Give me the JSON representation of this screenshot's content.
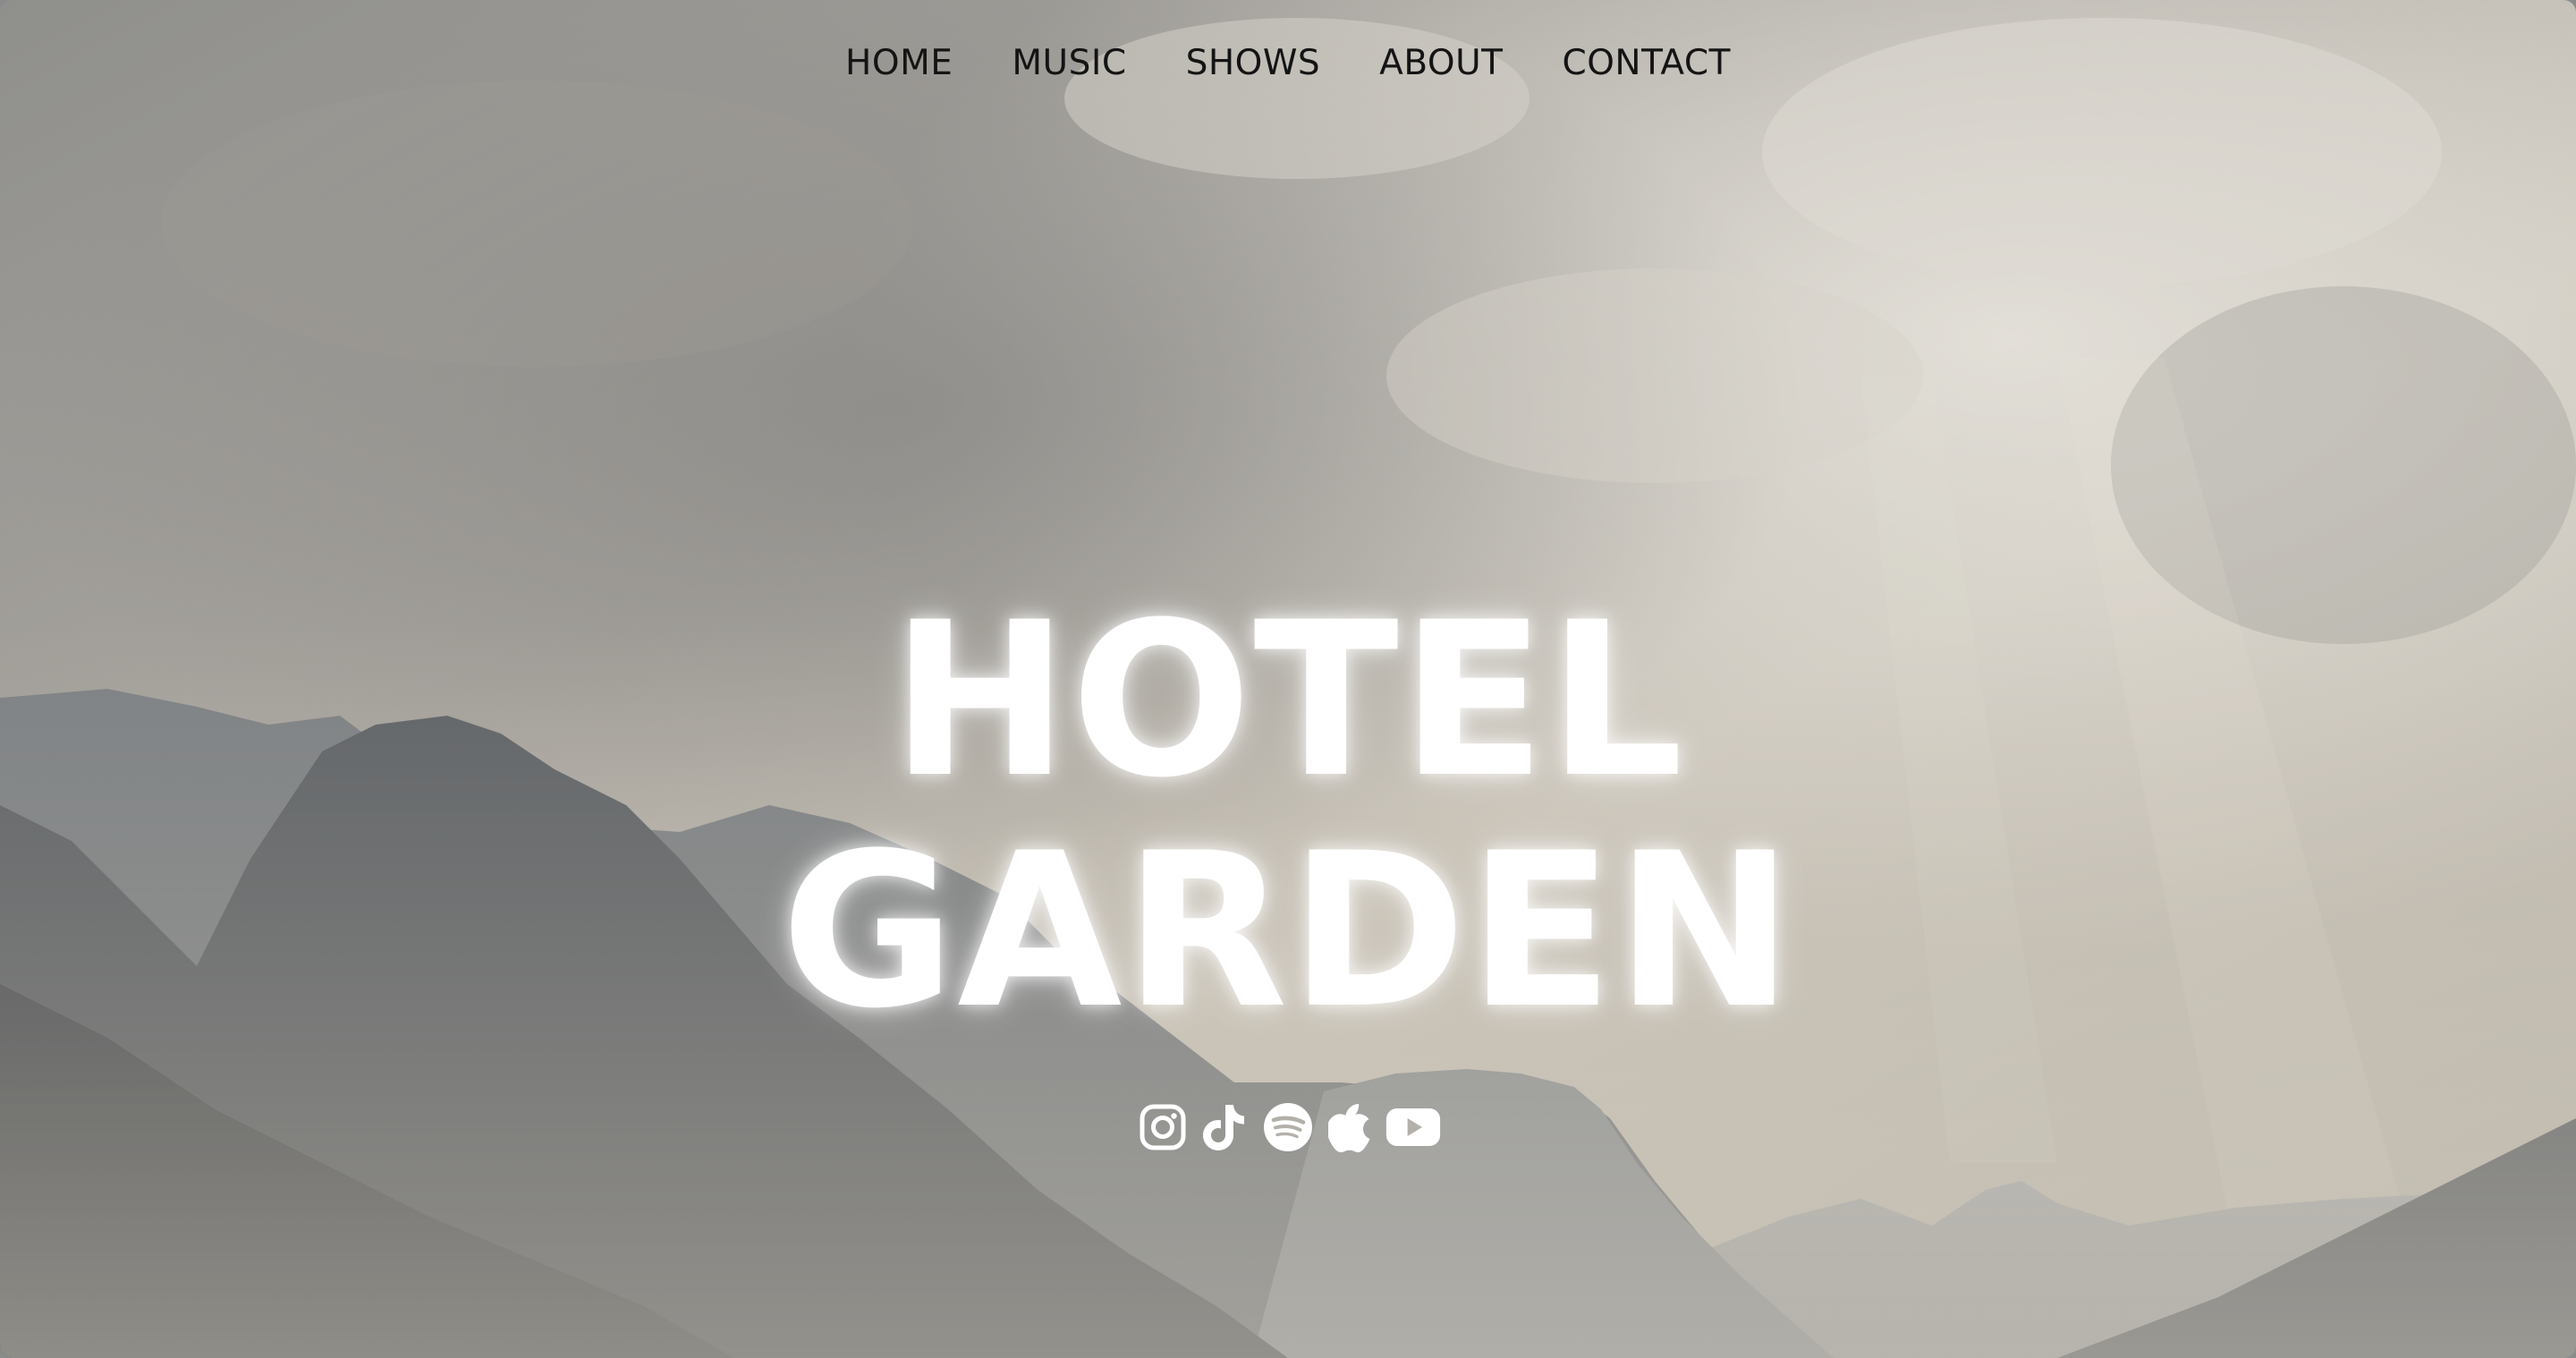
{
  "site": {
    "title_line1": "HOTEL",
    "title_line2": "GARDEN"
  },
  "nav": {
    "items": [
      {
        "label": "HOME"
      },
      {
        "label": "MUSIC"
      },
      {
        "label": "SHOWS"
      },
      {
        "label": "ABOUT"
      },
      {
        "label": "CONTACT"
      }
    ]
  },
  "social": {
    "icons": [
      "instagram-icon",
      "tiktok-icon",
      "spotify-icon",
      "apple-music-icon",
      "youtube-icon"
    ]
  },
  "colors": {
    "nav_text": "#141414",
    "title_text": "#ffffff",
    "icon_color": "#ffffff"
  },
  "background": {
    "description_icon": "mountain-landscape-image"
  }
}
